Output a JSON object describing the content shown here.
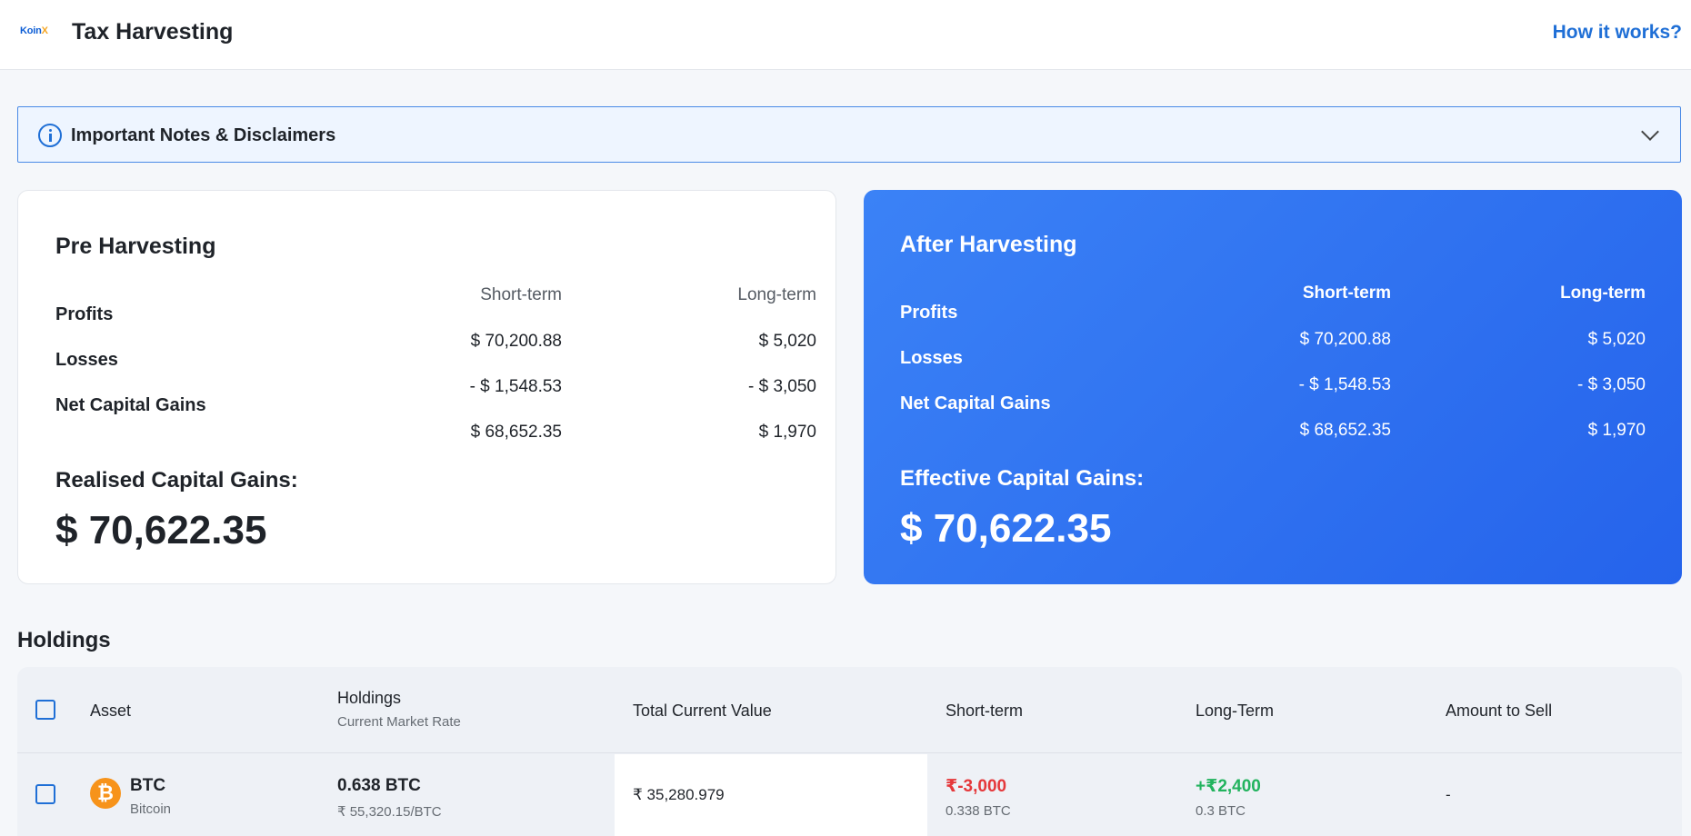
{
  "header": {
    "logo_main": "Koin",
    "logo_x": "X",
    "title": "Tax Harvesting",
    "help_link": "How it works?"
  },
  "notes": {
    "label": "Important Notes & Disclaimers",
    "icon": "info-icon",
    "toggle_icon": "chevron-down-icon"
  },
  "pre_harvesting": {
    "title": "Pre Harvesting",
    "columns": [
      "Short-term",
      "Long-term"
    ],
    "rows": [
      {
        "label": "Profits",
        "short": "$ 70,200.88",
        "long": "$ 5,020"
      },
      {
        "label": "Losses",
        "short": "- $ 1,548.53",
        "long": "- $ 3,050"
      },
      {
        "label": "Net Capital Gains",
        "short": "$ 68,652.35",
        "long": "$ 1,970"
      }
    ],
    "gains_label": "Realised Capital Gains:",
    "gains_value": "$ 70,622.35"
  },
  "after_harvesting": {
    "title": "After Harvesting",
    "columns": [
      "Short-term",
      "Long-term"
    ],
    "rows": [
      {
        "label": "Profits",
        "short": "$ 70,200.88",
        "long": "$ 5,020"
      },
      {
        "label": "Losses",
        "short": "- $ 1,548.53",
        "long": "- $ 3,050"
      },
      {
        "label": "Net Capital Gains",
        "short": "$ 68,652.35",
        "long": "$ 1,970"
      }
    ],
    "gains_label": "Effective Capital Gains:",
    "gains_value": "$ 70,622.35"
  },
  "holdings": {
    "title": "Holdings",
    "columns": {
      "asset": "Asset",
      "holdings": "Holdings",
      "holdings_sub": "Current Market Rate",
      "total_value": "Total Current Value",
      "short_term": "Short-term",
      "long_term": "Long-Term",
      "amount_to_sell": "Amount to Sell"
    },
    "rows": [
      {
        "symbol": "BTC",
        "name": "Bitcoin",
        "coin_glyph": "₿",
        "holdings": "0.638 BTC",
        "rate": "₹ 55,320.15/BTC",
        "total_value": "₹ 35,280.979",
        "short_term": "₹-3,000",
        "short_term_qty": "0.338 BTC",
        "long_term": "+₹2,400",
        "long_term_qty": "0.3 BTC",
        "amount_to_sell": "-"
      }
    ]
  },
  "colors": {
    "accent": "#1f6fd6",
    "after_card": "#3b82f6",
    "negative": "#e5383b",
    "positive": "#22b35e",
    "btc": "#f7931a"
  }
}
